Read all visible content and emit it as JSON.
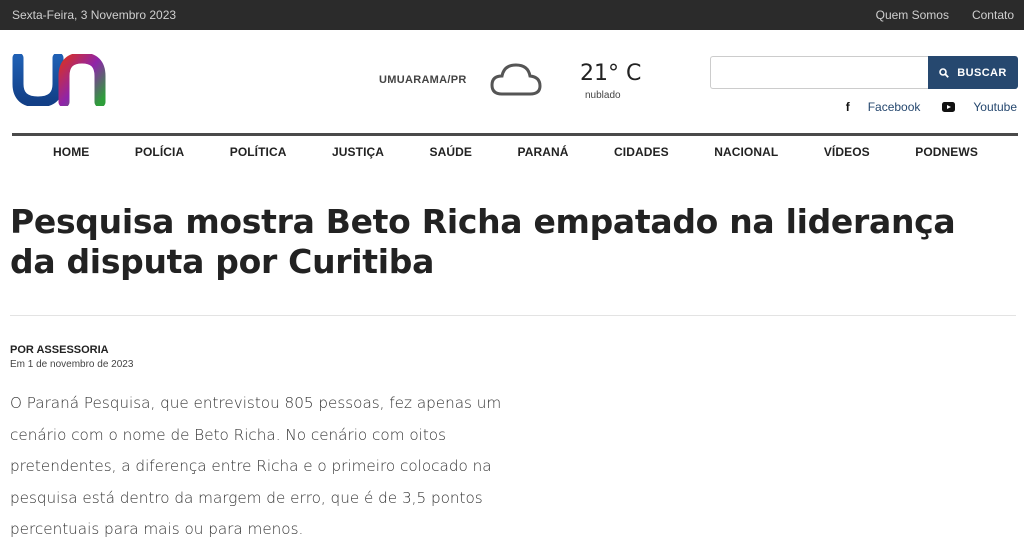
{
  "topbar": {
    "date": "Sexta-Feira, 3 Novembro 2023",
    "links": [
      "Quem Somos",
      "Contato"
    ]
  },
  "header": {
    "logo_icon": "un-logo",
    "city": "UMUARAMA/PR",
    "weather_icon": "cloud-icon",
    "temperature": "21° C",
    "condition": "nublado",
    "search": {
      "placeholder": "",
      "value": "",
      "button_label": "BUSCAR"
    },
    "social": [
      {
        "icon": "facebook-icon",
        "label": "Facebook"
      },
      {
        "icon": "youtube-icon",
        "label": "Youtube"
      }
    ]
  },
  "nav": {
    "items": [
      "HOME",
      "POLÍCIA",
      "POLÍTICA",
      "JUSTIÇA",
      "SAÚDE",
      "PARANÁ",
      "CIDADES",
      "NACIONAL",
      "VÍDEOS",
      "PODNEWS"
    ]
  },
  "article": {
    "headline": "Pesquisa mostra Beto Richa empatado na liderança da disputa por Curitiba",
    "author": "POR ASSESSORIA",
    "date": "Em 1 de novembro de 2023",
    "paragraph": "O Paraná Pesquisa, que entrevistou 805 pessoas, fez apenas um cenário com o nome de Beto Richa. No cenário com oitos pretendentes, a diferença entre Richa e o primeiro colocado na pesquisa está dentro da margem de erro, que é de 3,5 pontos percentuais para mais ou para menos."
  },
  "colors": {
    "topbar_bg": "#2b2b2b",
    "accent": "#26486f",
    "logo_blue": "#1f5fb3",
    "logo_red": "#c62828",
    "logo_green": "#2e9e3a"
  }
}
